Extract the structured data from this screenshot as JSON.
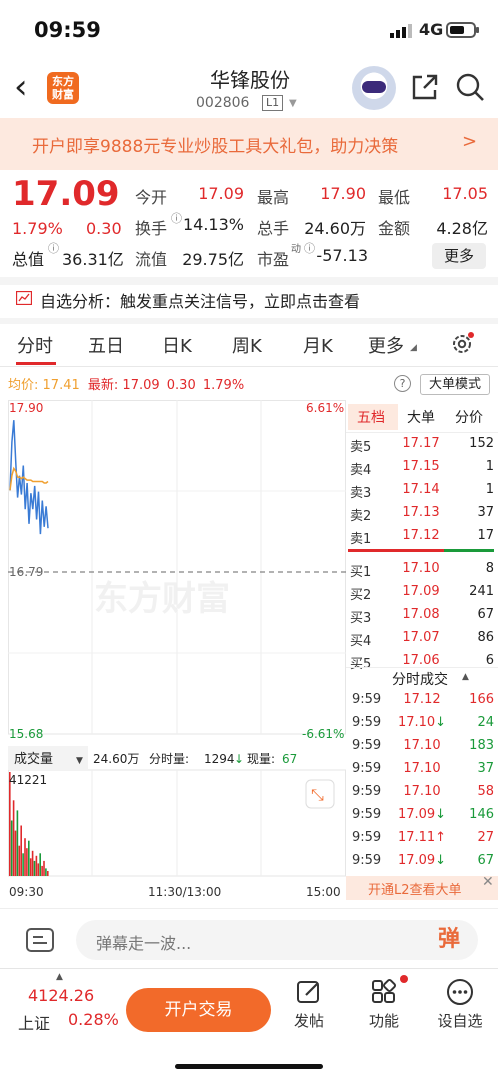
{
  "status": {
    "time": "09:59",
    "network": "4G"
  },
  "nav": {
    "logo_text": "东方财富",
    "stock_name": "华锋股份",
    "stock_code": "002806",
    "level": "L1"
  },
  "promo": {
    "text": "开户即享9888元专业炒股工具大礼包，助力决策",
    "arrow": ">"
  },
  "quote": {
    "price": "17.09",
    "change_pct": "1.79%",
    "change": "0.30",
    "mkt_cap_label": "总值",
    "mkt_cap": "36.31亿",
    "rows": [
      [
        {
          "label": "今开",
          "value": "17.09",
          "color": "red"
        },
        {
          "label": "最高",
          "value": "17.90",
          "color": "red"
        },
        {
          "label": "最低",
          "value": "17.05",
          "color": "red"
        }
      ],
      [
        {
          "label": "换手",
          "value": "14.13%",
          "color": "black"
        },
        {
          "label": "总手",
          "value": "24.60万",
          "color": "black"
        },
        {
          "label": "金额",
          "value": "4.28亿",
          "color": "black"
        }
      ],
      [
        {
          "label": "流值",
          "value": "29.75亿",
          "color": "black"
        },
        {
          "label": "市盈",
          "value": "-57.13",
          "color": "black",
          "sup": "动"
        }
      ]
    ],
    "more_label": "更多"
  },
  "analysis": {
    "text": "自选分析：触发重点关注信号，立即点击查看"
  },
  "tabs": [
    "分时",
    "五日",
    "日K",
    "周K",
    "月K",
    "更多"
  ],
  "avgbar": {
    "avg_label": "均价:",
    "avg_value": "17.41",
    "latest_label": "最新:",
    "latest_value": "17.09",
    "latest_change": "0.30",
    "latest_pct": "1.79%",
    "help": "?",
    "big_order_label": "大单模式"
  },
  "chart_data": {
    "type": "line",
    "title": "",
    "y_left_max": "17.90",
    "y_left_mid": "16.79",
    "y_left_min": "15.68",
    "y_right_max": "6.61%",
    "y_right_min": "-6.61%",
    "ylim": [
      15.68,
      17.9
    ],
    "x_ticks": [
      "09:30",
      "11:30/13:00",
      "15:00"
    ],
    "watermark": "东方财富",
    "price_series": [
      17.35,
      17.68,
      17.83,
      17.55,
      17.3,
      17.45,
      17.32,
      17.52,
      17.22,
      17.4,
      17.12,
      17.33,
      17.22,
      17.38,
      17.15,
      17.34,
      17.05,
      17.28,
      17.1,
      17.24,
      17.09
    ],
    "avg_series": [
      17.35,
      17.45,
      17.5,
      17.48,
      17.44,
      17.44,
      17.43,
      17.44,
      17.43,
      17.42,
      17.42,
      17.42,
      17.41,
      17.41,
      17.41,
      17.41,
      17.41,
      17.41,
      17.4,
      17.4,
      17.41
    ],
    "volume": {
      "label": "成交量",
      "total": "24.60万",
      "period_label": "分时量:",
      "period_value": "1294",
      "current_label": "现量:",
      "current_value": "67",
      "max_label": "41221",
      "bars": [
        41221,
        22000,
        30000,
        18000,
        26000,
        12000,
        20000,
        9000,
        15000,
        11000,
        14000,
        7000,
        10000,
        6000,
        8000,
        5000,
        9000,
        4000,
        6000,
        3000,
        2000
      ]
    }
  },
  "orderbook": {
    "tabs": [
      "五档",
      "大单",
      "分价"
    ],
    "asks": [
      {
        "label": "卖5",
        "price": "17.17",
        "vol": "152"
      },
      {
        "label": "卖4",
        "price": "17.15",
        "vol": "1"
      },
      {
        "label": "卖3",
        "price": "17.14",
        "vol": "1"
      },
      {
        "label": "卖2",
        "price": "17.13",
        "vol": "37"
      },
      {
        "label": "卖1",
        "price": "17.12",
        "vol": "17"
      }
    ],
    "bids": [
      {
        "label": "买1",
        "price": "17.10",
        "vol": "8"
      },
      {
        "label": "买2",
        "price": "17.09",
        "vol": "241"
      },
      {
        "label": "买3",
        "price": "17.08",
        "vol": "67"
      },
      {
        "label": "买4",
        "price": "17.07",
        "vol": "86"
      },
      {
        "label": "买5",
        "price": "17.06",
        "vol": "6"
      }
    ],
    "trades_title": "分时成交",
    "trades": [
      {
        "time": "9:59",
        "price": "17.12",
        "dir": "",
        "vol": "166",
        "color": "red"
      },
      {
        "time": "9:59",
        "price": "17.10",
        "dir": "↓",
        "vol": "24",
        "color": "green"
      },
      {
        "time": "9:59",
        "price": "17.10",
        "dir": "",
        "vol": "183",
        "color": "green"
      },
      {
        "time": "9:59",
        "price": "17.10",
        "dir": "",
        "vol": "37",
        "color": "green"
      },
      {
        "time": "9:59",
        "price": "17.10",
        "dir": "",
        "vol": "58",
        "color": "red"
      },
      {
        "time": "9:59",
        "price": "17.09",
        "dir": "↓",
        "vol": "146",
        "color": "green"
      },
      {
        "time": "9:59",
        "price": "17.11",
        "dir": "↑",
        "vol": "27",
        "color": "red"
      },
      {
        "time": "9:59",
        "price": "17.09",
        "dir": "↓",
        "vol": "67",
        "color": "green"
      }
    ],
    "l2_text": "开通L2查看大单",
    "l2_close": "✕"
  },
  "comment": {
    "placeholder": "弹幕走一波...",
    "danmu_btn": "弹"
  },
  "bottom": {
    "index_value": "4124.26",
    "index_name": "上证",
    "index_pct": "0.28%",
    "trade_btn": "开户交易",
    "buttons": [
      "发帖",
      "功能",
      "设自选"
    ]
  },
  "colors": {
    "up": "#e0292b",
    "down": "#1a9a3a",
    "accent": "#f26a2a",
    "price_line": "#3a7bd5",
    "avg_line": "#f0a030"
  }
}
